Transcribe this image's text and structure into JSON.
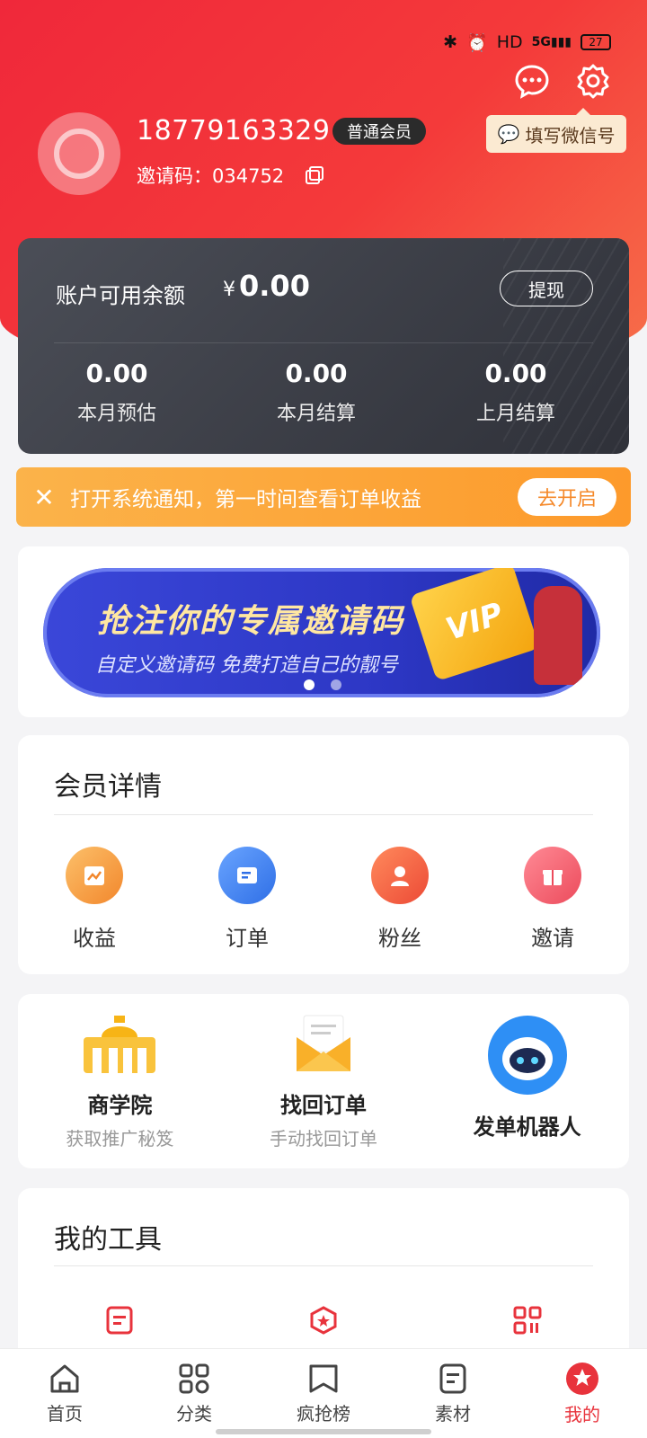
{
  "status_bar": {
    "network": "HD",
    "signal": "5G",
    "battery": "27"
  },
  "header": {
    "wechat_tip": "填写微信号",
    "phone": "18779163329",
    "member_level": "普通会员",
    "invite_code_label": "邀请码：034752"
  },
  "balance": {
    "label": "账户可用余额",
    "currency": "¥",
    "amount": "0.00",
    "withdraw_label": "提现",
    "stats": [
      {
        "value": "0.00",
        "label": "本月预估"
      },
      {
        "value": "0.00",
        "label": "本月结算"
      },
      {
        "value": "0.00",
        "label": "上月结算"
      }
    ]
  },
  "notice": {
    "text": "打开系统通知，第一时间查看订单收益",
    "button": "去开启"
  },
  "banner": {
    "title": "抢注你的专属邀请码",
    "subtitle": "自定义邀请码 免费打造自己的靓号",
    "badge": "VIP"
  },
  "member": {
    "title": "会员详情",
    "items": [
      {
        "label": "收益",
        "color": "#f79a3c"
      },
      {
        "label": "订单",
        "color": "#3d7ff0"
      },
      {
        "label": "粉丝",
        "color": "#f25a3a"
      },
      {
        "label": "邀请",
        "color": "#f05a66"
      }
    ]
  },
  "features": {
    "items": [
      {
        "title": "商学院",
        "sub": "获取推广秘笈"
      },
      {
        "title": "找回订单",
        "sub": "手动找回订单"
      },
      {
        "title": "发单机器人",
        "sub": ""
      }
    ]
  },
  "tools": {
    "title": "我的工具"
  },
  "tabbar": {
    "items": [
      {
        "label": "首页"
      },
      {
        "label": "分类"
      },
      {
        "label": "疯抢榜"
      },
      {
        "label": "素材"
      },
      {
        "label": "我的"
      }
    ]
  },
  "colors": {
    "brand_red": "#e8333c",
    "notice_orange": "#fd9a2b",
    "card_dark": "#34363e"
  }
}
